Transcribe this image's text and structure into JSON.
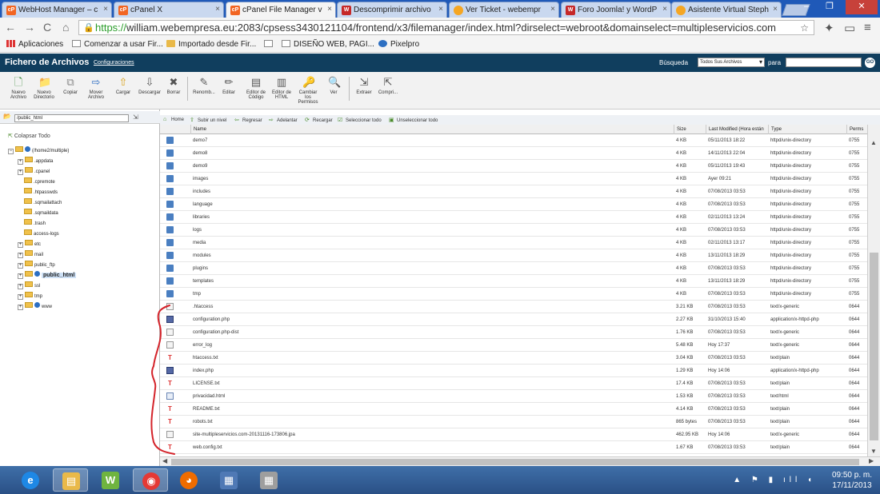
{
  "browser": {
    "tabs": [
      {
        "label": "WebHost Manager – c",
        "favicon": "cpanel",
        "active": false
      },
      {
        "label": "cPanel X",
        "favicon": "cpanel",
        "active": false
      },
      {
        "label": "cPanel File Manager v",
        "favicon": "cpanel",
        "active": true
      },
      {
        "label": "Descomprimir archivo",
        "favicon": "webempresa",
        "active": false
      },
      {
        "label": "Ver Ticket - webempr",
        "favicon": "circle-orange",
        "active": false
      },
      {
        "label": "Foro Joomla! y WordP",
        "favicon": "webempresa",
        "active": false
      },
      {
        "label": "Asistente Virtual Steph",
        "favicon": "circle-orange",
        "active": false
      }
    ],
    "url_scheme": "https://",
    "url_rest": "william.webempresa.eu:2083/cpsess3430121104/frontend/x3/filemanager/index.html?dirselect=webroot&domainselect=multipleservicios.com",
    "bookmarks": [
      "Aplicaciones",
      "Comenzar a usar Fir...",
      "Importado desde Fir...",
      "",
      "DISEÑO WEB, PAGI...",
      "Pixelpro"
    ]
  },
  "fm": {
    "title": "Fichero de Archivos",
    "config_link": "Configuraciones",
    "search_label": "Búsqueda",
    "search_select": "Todos Sus Archivos",
    "para_label": "para",
    "go_label": "GO",
    "toolbar": [
      {
        "label": "Nuevo Archivo",
        "icon": "new-file-icon"
      },
      {
        "label": "Nuevo Directorio",
        "icon": "new-folder-icon"
      },
      {
        "label": "Copiar",
        "icon": "copy-icon"
      },
      {
        "label": "Mover Archivo",
        "icon": "move-icon"
      },
      {
        "label": "Cargar",
        "icon": "upload-icon"
      },
      {
        "label": "Descargar",
        "icon": "download-icon"
      },
      {
        "label": "Borrar",
        "icon": "delete-icon"
      },
      {
        "label": "Renomb...",
        "icon": "rename-icon"
      },
      {
        "label": "Editar",
        "icon": "edit-icon"
      },
      {
        "label": "Editor de Código",
        "icon": "code-editor-icon"
      },
      {
        "label": "Editor de HTML",
        "icon": "html-editor-icon"
      },
      {
        "label": "Cambiar los Permisos",
        "icon": "permissions-icon"
      },
      {
        "label": "Ver",
        "icon": "view-icon"
      },
      {
        "label": "Extraer",
        "icon": "extract-icon"
      },
      {
        "label": "Compri...",
        "icon": "compress-icon"
      }
    ],
    "path_value": "/public_html",
    "collapse_all": "Colapsar Todo",
    "tree": [
      {
        "label": "(/home2/multiple)",
        "level": 0
      },
      {
        "label": ".appdata",
        "level": 1
      },
      {
        "label": ".cpanel",
        "level": 1
      },
      {
        "label": ".cpremote",
        "level": 1
      },
      {
        "label": ".htpasswds",
        "level": 1
      },
      {
        "label": ".sqmailattach",
        "level": 1
      },
      {
        "label": ".sqmaildata",
        "level": 1
      },
      {
        "label": ".trash",
        "level": 1
      },
      {
        "label": "access-logs",
        "level": 1
      },
      {
        "label": "etc",
        "level": 1
      },
      {
        "label": "mail",
        "level": 1
      },
      {
        "label": "public_ftp",
        "level": 1
      },
      {
        "label": "public_html",
        "level": 1
      },
      {
        "label": "ssl",
        "level": 1
      },
      {
        "label": "tmp",
        "level": 1
      },
      {
        "label": "www",
        "level": 1
      }
    ],
    "navbar": [
      "Home",
      "Subir un nivel",
      "Regresar",
      "Adelantar",
      "Recargar",
      "Seleccionar todo",
      "Unseleccionar todo"
    ],
    "columns": [
      "Name",
      "Size",
      "Last Modified (Hora están",
      "Type",
      "Perms"
    ],
    "files": [
      {
        "name": "demo7",
        "size": "4 KB",
        "modified": "05/11/2013 18:22",
        "type": "httpd/unix-directory",
        "perms": "0755",
        "kind": "dir"
      },
      {
        "name": "demo8",
        "size": "4 KB",
        "modified": "14/11/2013 22:04",
        "type": "httpd/unix-directory",
        "perms": "0755",
        "kind": "dir"
      },
      {
        "name": "demo9",
        "size": "4 KB",
        "modified": "05/11/2013 19:43",
        "type": "httpd/unix-directory",
        "perms": "0755",
        "kind": "dir"
      },
      {
        "name": "images",
        "size": "4 KB",
        "modified": "Ayer 09:21",
        "type": "httpd/unix-directory",
        "perms": "0755",
        "kind": "dir"
      },
      {
        "name": "includes",
        "size": "4 KB",
        "modified": "07/08/2013 03:53",
        "type": "httpd/unix-directory",
        "perms": "0755",
        "kind": "dir"
      },
      {
        "name": "language",
        "size": "4 KB",
        "modified": "07/08/2013 03:53",
        "type": "httpd/unix-directory",
        "perms": "0755",
        "kind": "dir"
      },
      {
        "name": "libraries",
        "size": "4 KB",
        "modified": "02/11/2013 13:24",
        "type": "httpd/unix-directory",
        "perms": "0755",
        "kind": "dir"
      },
      {
        "name": "logs",
        "size": "4 KB",
        "modified": "07/08/2013 03:53",
        "type": "httpd/unix-directory",
        "perms": "0755",
        "kind": "dir"
      },
      {
        "name": "media",
        "size": "4 KB",
        "modified": "02/11/2013 13:17",
        "type": "httpd/unix-directory",
        "perms": "0755",
        "kind": "dir"
      },
      {
        "name": "modules",
        "size": "4 KB",
        "modified": "13/11/2013 18:29",
        "type": "httpd/unix-directory",
        "perms": "0755",
        "kind": "dir"
      },
      {
        "name": "plugins",
        "size": "4 KB",
        "modified": "07/08/2013 03:53",
        "type": "httpd/unix-directory",
        "perms": "0755",
        "kind": "dir"
      },
      {
        "name": "templates",
        "size": "4 KB",
        "modified": "13/11/2013 18:29",
        "type": "httpd/unix-directory",
        "perms": "0755",
        "kind": "dir"
      },
      {
        "name": "tmp",
        "size": "4 KB",
        "modified": "07/08/2013 03:53",
        "type": "httpd/unix-directory",
        "perms": "0755",
        "kind": "dir"
      },
      {
        "name": ".htaccess",
        "size": "3.21 KB",
        "modified": "07/08/2013 03:53",
        "type": "text/x-generic",
        "perms": "0644",
        "kind": "file"
      },
      {
        "name": "configuration.php",
        "size": "2.27 KB",
        "modified": "31/10/2013 15:40",
        "type": "application/x-httpd-php",
        "perms": "0644",
        "kind": "php"
      },
      {
        "name": "configuration.php-dist",
        "size": "1.76 KB",
        "modified": "07/08/2013 03:53",
        "type": "text/x-generic",
        "perms": "0644",
        "kind": "file"
      },
      {
        "name": "error_log",
        "size": "5.48 KB",
        "modified": "Hoy 17:37",
        "type": "text/x-generic",
        "perms": "0644",
        "kind": "file"
      },
      {
        "name": "htaccess.txt",
        "size": "3.04 KB",
        "modified": "07/08/2013 03:53",
        "type": "text/plain",
        "perms": "0644",
        "kind": "txt"
      },
      {
        "name": "index.php",
        "size": "1.29 KB",
        "modified": "Hoy 14:06",
        "type": "application/x-httpd-php",
        "perms": "0644",
        "kind": "php"
      },
      {
        "name": "LICENSE.txt",
        "size": "17.4 KB",
        "modified": "07/08/2013 03:53",
        "type": "text/plain",
        "perms": "0644",
        "kind": "txt"
      },
      {
        "name": "privacidad.html",
        "size": "1.53 KB",
        "modified": "07/08/2013 03:53",
        "type": "text/html",
        "perms": "0644",
        "kind": "html"
      },
      {
        "name": "README.txt",
        "size": "4.14 KB",
        "modified": "07/08/2013 03:53",
        "type": "text/plain",
        "perms": "0644",
        "kind": "txt"
      },
      {
        "name": "robots.txt",
        "size": "865 bytes",
        "modified": "07/08/2013 03:53",
        "type": "text/plain",
        "perms": "0644",
        "kind": "txt"
      },
      {
        "name": "site-multipleservicios.com-20131116-173806.jpa",
        "size": "462.95 KB",
        "modified": "Hoy 14:06",
        "type": "text/x-generic",
        "perms": "0644",
        "kind": "file"
      },
      {
        "name": "web.config.txt",
        "size": "1.67 KB",
        "modified": "07/08/2013 03:53",
        "type": "text/plain",
        "perms": "0644",
        "kind": "txt"
      }
    ]
  },
  "taskbar": {
    "apps": [
      "ie-icon",
      "explorer-icon",
      "webempresa-icon",
      "chrome-icon",
      "firefox-icon",
      "network-icon",
      "calculator-icon"
    ],
    "time": "09:50 p. m.",
    "date": "17/11/2013"
  },
  "colors": {
    "header": "#103e5e",
    "tabstrip": "#1f59b8",
    "annotation": "#d4232a"
  }
}
